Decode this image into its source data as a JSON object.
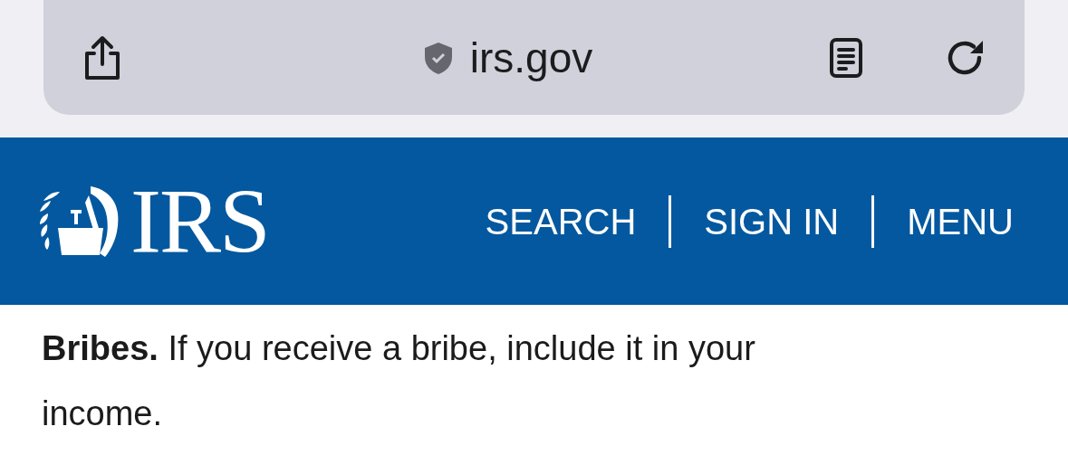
{
  "browser_bar": {
    "url": "irs.gov"
  },
  "header": {
    "logo_text": "IRS",
    "nav": [
      "SEARCH",
      "SIGN IN",
      "MENU"
    ]
  },
  "content": {
    "paragraph": "**Bribes.** If you receive a bribe, include it in your income."
  }
}
